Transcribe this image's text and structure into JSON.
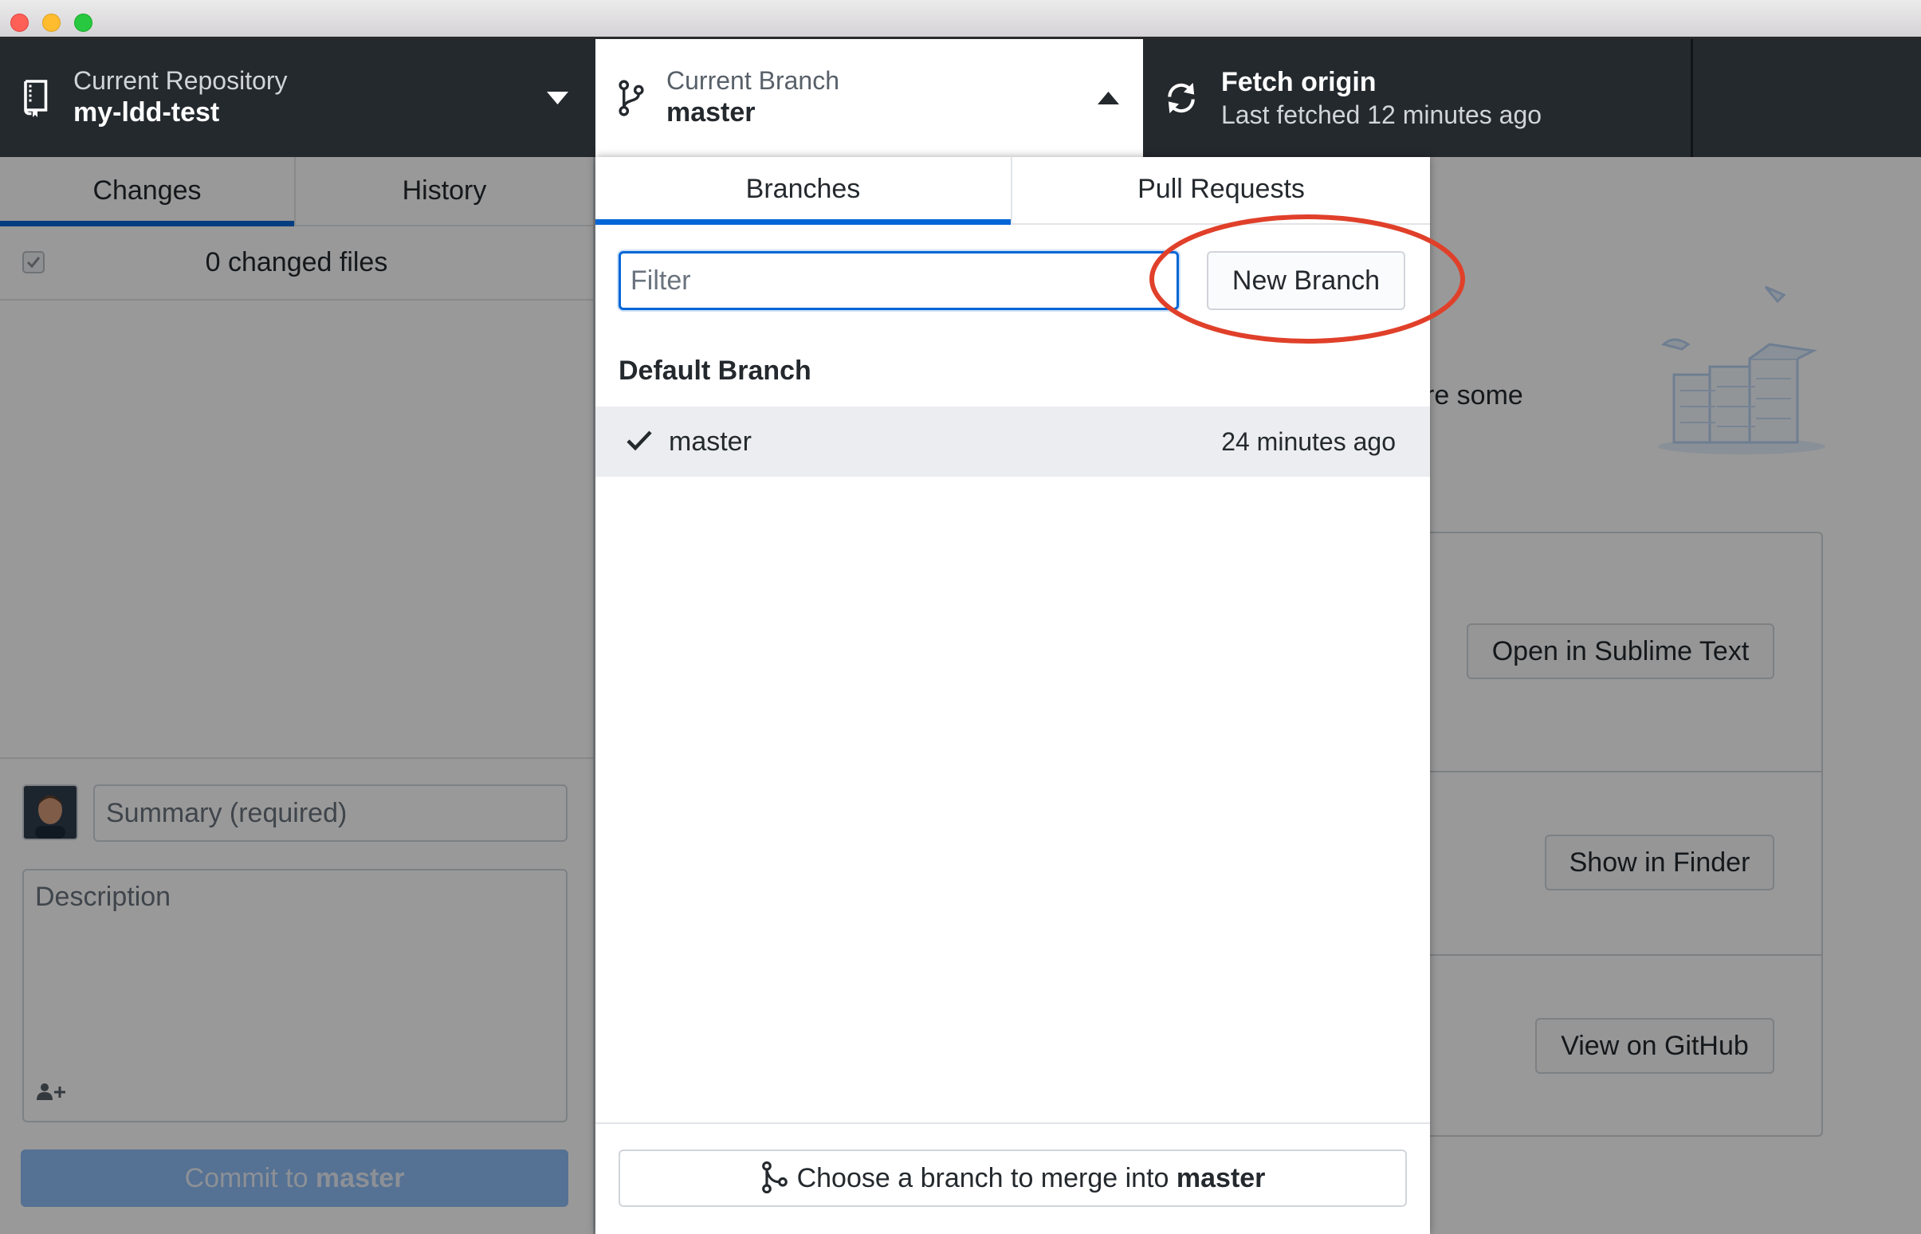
{
  "window": {
    "traffic_lights": [
      "close",
      "minimize",
      "zoom"
    ]
  },
  "toolbar": {
    "repository": {
      "label": "Current Repository",
      "value": "my-ldd-test",
      "icon": "repo-icon",
      "caret": "caret-down-icon"
    },
    "branch": {
      "label": "Current Branch",
      "value": "master",
      "icon": "git-branch-icon",
      "caret": "caret-up-icon"
    },
    "fetch": {
      "title": "Fetch origin",
      "subtitle": "Last fetched 12 minutes ago",
      "icon": "sync-icon"
    }
  },
  "sidebar": {
    "tabs": [
      {
        "label": "Changes",
        "selected": true
      },
      {
        "label": "History",
        "selected": false
      }
    ],
    "changed_files": "0 changed files",
    "summary_placeholder": "Summary (required)",
    "description_placeholder": "Description",
    "commit_prefix": "Commit to ",
    "commit_branch": "master"
  },
  "branch_menu": {
    "tabs": [
      {
        "label": "Branches",
        "selected": true
      },
      {
        "label": "Pull Requests",
        "selected": false
      }
    ],
    "filter_placeholder": "Filter",
    "new_branch_label": "New Branch",
    "group_title": "Default Branch",
    "branches": [
      {
        "name": "master",
        "time": "24 minutes ago",
        "current": true
      }
    ],
    "merge_prefix": "Choose a branch to merge into ",
    "merge_branch": "master"
  },
  "main": {
    "blurb_fragment": "re some",
    "actions": [
      {
        "label": "Open in Sublime Text"
      },
      {
        "label": "Show in Finder"
      },
      {
        "label": "View on GitHub"
      }
    ]
  },
  "colors": {
    "toolbar_bg": "#24292e",
    "accent": "#0366d6",
    "annotation": "#e0402a",
    "overlay": "rgba(0,0,0,0.4)"
  }
}
